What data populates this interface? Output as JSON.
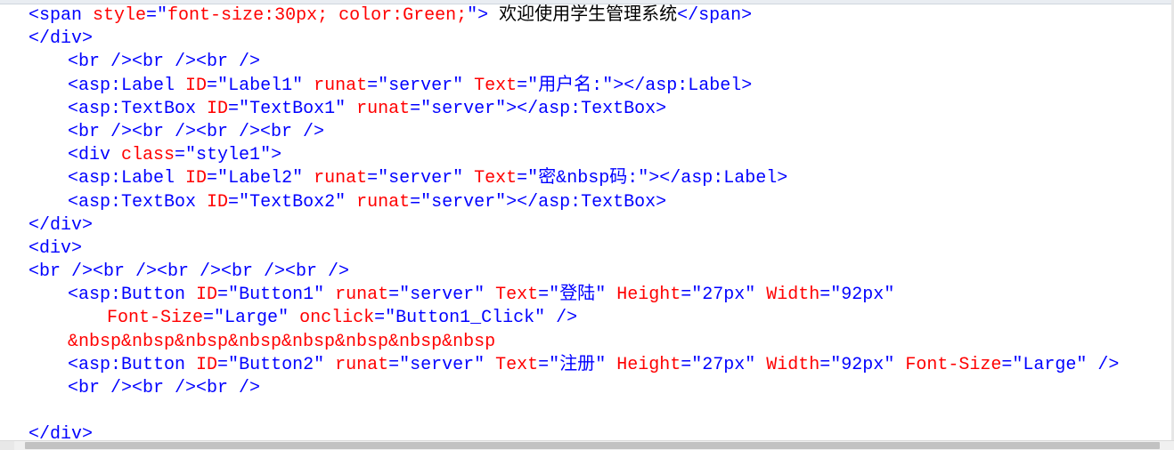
{
  "colors": {
    "tag": "#0000ff",
    "attribute": "#ff0000",
    "value": "#0000ff",
    "text": "#000000",
    "entity": "#ff0000"
  },
  "lines": [
    {
      "tokens": [
        [
          "t",
          "<span "
        ],
        [
          "a",
          "style"
        ],
        [
          "t",
          "=\""
        ],
        [
          "a",
          "font-size:30px; color:Green;"
        ],
        [
          "t",
          "\">"
        ],
        [
          "x",
          " 欢迎使用学生管理系统"
        ],
        [
          "t",
          "</span>"
        ]
      ]
    },
    {
      "tokens": [
        [
          "t",
          "</div>"
        ]
      ]
    },
    {
      "tokens": [
        [
          "t",
          "<br /><br /><br />"
        ]
      ]
    },
    {
      "tokens": [
        [
          "t",
          "<asp:Label "
        ],
        [
          "a",
          "ID"
        ],
        [
          "t",
          "=\""
        ],
        [
          "v",
          "Label1"
        ],
        [
          "t",
          "\" "
        ],
        [
          "a",
          "runat"
        ],
        [
          "t",
          "=\""
        ],
        [
          "v",
          "server"
        ],
        [
          "t",
          "\" "
        ],
        [
          "a",
          "Text"
        ],
        [
          "t",
          "=\""
        ],
        [
          "v",
          "用户名:"
        ],
        [
          "t",
          "\"></asp:Label>"
        ]
      ]
    },
    {
      "tokens": [
        [
          "t",
          "<asp:TextBox "
        ],
        [
          "a",
          "ID"
        ],
        [
          "t",
          "=\""
        ],
        [
          "v",
          "TextBox1"
        ],
        [
          "t",
          "\" "
        ],
        [
          "a",
          "runat"
        ],
        [
          "t",
          "=\""
        ],
        [
          "v",
          "server"
        ],
        [
          "t",
          "\"></asp:TextBox>"
        ]
      ]
    },
    {
      "tokens": [
        [
          "t",
          "<br /><br /><br /><br />"
        ]
      ]
    },
    {
      "tokens": [
        [
          "t",
          "<div "
        ],
        [
          "a",
          "class"
        ],
        [
          "t",
          "=\""
        ],
        [
          "v",
          "style1"
        ],
        [
          "t",
          "\">"
        ]
      ]
    },
    {
      "tokens": [
        [
          "t",
          "<asp:Label "
        ],
        [
          "a",
          "ID"
        ],
        [
          "t",
          "=\""
        ],
        [
          "v",
          "Label2"
        ],
        [
          "t",
          "\" "
        ],
        [
          "a",
          "runat"
        ],
        [
          "t",
          "=\""
        ],
        [
          "v",
          "server"
        ],
        [
          "t",
          "\" "
        ],
        [
          "a",
          "Text"
        ],
        [
          "t",
          "=\""
        ],
        [
          "v",
          "密&nbsp码:"
        ],
        [
          "t",
          "\"></asp:Label>"
        ]
      ]
    },
    {
      "tokens": [
        [
          "t",
          "<asp:TextBox "
        ],
        [
          "a",
          "ID"
        ],
        [
          "t",
          "=\""
        ],
        [
          "v",
          "TextBox2"
        ],
        [
          "t",
          "\" "
        ],
        [
          "a",
          "runat"
        ],
        [
          "t",
          "=\""
        ],
        [
          "v",
          "server"
        ],
        [
          "t",
          "\"></asp:TextBox>"
        ]
      ]
    },
    {
      "tokens": [
        [
          "t",
          "</div>"
        ]
      ]
    },
    {
      "tokens": [
        [
          "t",
          "<div>"
        ]
      ]
    },
    {
      "tokens": [
        [
          "t",
          "<br /><br /><br /><br /><br />"
        ]
      ]
    },
    {
      "tokens": [
        [
          "t",
          "<asp:Button "
        ],
        [
          "a",
          "ID"
        ],
        [
          "t",
          "=\""
        ],
        [
          "v",
          "Button1"
        ],
        [
          "t",
          "\" "
        ],
        [
          "a",
          "runat"
        ],
        [
          "t",
          "=\""
        ],
        [
          "v",
          "server"
        ],
        [
          "t",
          "\" "
        ],
        [
          "a",
          "Text"
        ],
        [
          "t",
          "=\""
        ],
        [
          "v",
          "登陆"
        ],
        [
          "t",
          "\" "
        ],
        [
          "a",
          "Height"
        ],
        [
          "t",
          "=\""
        ],
        [
          "v",
          "27px"
        ],
        [
          "t",
          "\" "
        ],
        [
          "a",
          "Width"
        ],
        [
          "t",
          "=\""
        ],
        [
          "v",
          "92px"
        ],
        [
          "t",
          "\""
        ]
      ]
    },
    {
      "tokens": [
        [
          "a",
          "Font-Size"
        ],
        [
          "t",
          "=\""
        ],
        [
          "v",
          "Large"
        ],
        [
          "t",
          "\" "
        ],
        [
          "a",
          "onclick"
        ],
        [
          "t",
          "=\""
        ],
        [
          "v",
          "Button1_Click"
        ],
        [
          "t",
          "\" />"
        ]
      ]
    },
    {
      "tokens": [
        [
          "a",
          "&nbsp&nbsp&nbsp&nbsp&nbsp&nbsp&nbsp&nbsp"
        ]
      ]
    },
    {
      "tokens": [
        [
          "t",
          "<asp:Button "
        ],
        [
          "a",
          "ID"
        ],
        [
          "t",
          "=\""
        ],
        [
          "v",
          "Button2"
        ],
        [
          "t",
          "\" "
        ],
        [
          "a",
          "runat"
        ],
        [
          "t",
          "=\""
        ],
        [
          "v",
          "server"
        ],
        [
          "t",
          "\" "
        ],
        [
          "a",
          "Text"
        ],
        [
          "t",
          "=\""
        ],
        [
          "v",
          "注册"
        ],
        [
          "t",
          "\" "
        ],
        [
          "a",
          "Height"
        ],
        [
          "t",
          "=\""
        ],
        [
          "v",
          "27px"
        ],
        [
          "t",
          "\" "
        ],
        [
          "a",
          "Width"
        ],
        [
          "t",
          "=\""
        ],
        [
          "v",
          "92px"
        ],
        [
          "t",
          "\" "
        ],
        [
          "a",
          "Font-Size"
        ],
        [
          "t",
          "=\""
        ],
        [
          "v",
          "Large"
        ],
        [
          "t",
          "\" />"
        ]
      ]
    },
    {
      "tokens": [
        [
          "t",
          "<br /><br /><br />"
        ]
      ]
    },
    {
      "tokens": []
    },
    {
      "tokens": [
        [
          "t",
          "</div>"
        ]
      ]
    }
  ]
}
